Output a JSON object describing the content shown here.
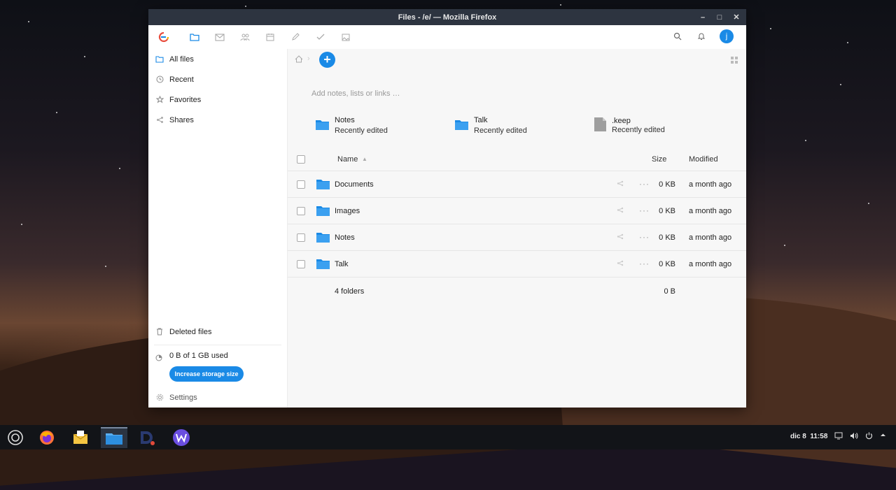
{
  "window": {
    "title": "Files - /e/ — Mozilla Firefox",
    "controls": {
      "minimize": "–",
      "maximize": "□",
      "close": "✕"
    }
  },
  "appbar": {
    "apps": [
      "files",
      "mail",
      "contacts",
      "calendar",
      "notes",
      "tasks",
      "photos"
    ],
    "avatar_initial": "j"
  },
  "sidebar": {
    "items": [
      {
        "label": "All files",
        "icon": "folder-icon"
      },
      {
        "label": "Recent",
        "icon": "clock-icon"
      },
      {
        "label": "Favorites",
        "icon": "star-icon"
      },
      {
        "label": "Shares",
        "icon": "share-icon"
      }
    ],
    "deleted_files": "Deleted files",
    "quota": "0 B of 1 GB used",
    "storage_button": "Increase storage size",
    "settings": "Settings"
  },
  "main": {
    "note_placeholder": "Add notes, lists or links …",
    "recent": [
      {
        "name": "Notes",
        "sub": "Recently edited",
        "kind": "folder"
      },
      {
        "name": "Talk",
        "sub": "Recently edited",
        "kind": "folder"
      },
      {
        "name": ".keep",
        "sub": "Recently edited",
        "kind": "file"
      }
    ],
    "columns": {
      "name": "Name",
      "size": "Size",
      "modified": "Modified"
    },
    "rows": [
      {
        "name": "Documents",
        "size": "0 KB",
        "modified": "a month ago"
      },
      {
        "name": "Images",
        "size": "0 KB",
        "modified": "a month ago"
      },
      {
        "name": "Notes",
        "size": "0 KB",
        "modified": "a month ago"
      },
      {
        "name": "Talk",
        "size": "0 KB",
        "modified": "a month ago"
      }
    ],
    "summary": {
      "count": "4 folders",
      "size": "0 B"
    }
  },
  "taskbar": {
    "date": "dic 8",
    "time": "11:58"
  },
  "colors": {
    "accent": "#1a8ae6",
    "titlebar": "#2d3440",
    "taskbar": "#121418"
  }
}
